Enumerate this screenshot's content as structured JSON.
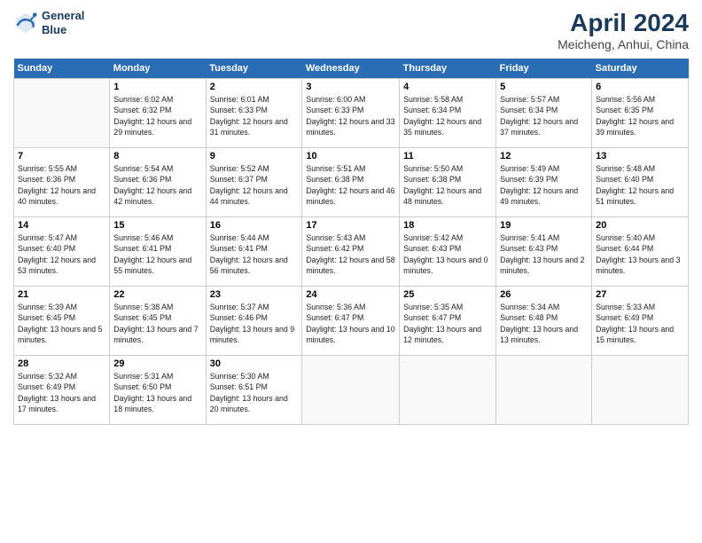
{
  "header": {
    "logo_line1": "General",
    "logo_line2": "Blue",
    "month": "April 2024",
    "location": "Meicheng, Anhui, China"
  },
  "days_of_week": [
    "Sunday",
    "Monday",
    "Tuesday",
    "Wednesday",
    "Thursday",
    "Friday",
    "Saturday"
  ],
  "weeks": [
    [
      {
        "day": "",
        "sunrise": "",
        "sunset": "",
        "daylight": ""
      },
      {
        "day": "1",
        "sunrise": "Sunrise: 6:02 AM",
        "sunset": "Sunset: 6:32 PM",
        "daylight": "Daylight: 12 hours and 29 minutes."
      },
      {
        "day": "2",
        "sunrise": "Sunrise: 6:01 AM",
        "sunset": "Sunset: 6:33 PM",
        "daylight": "Daylight: 12 hours and 31 minutes."
      },
      {
        "day": "3",
        "sunrise": "Sunrise: 6:00 AM",
        "sunset": "Sunset: 6:33 PM",
        "daylight": "Daylight: 12 hours and 33 minutes."
      },
      {
        "day": "4",
        "sunrise": "Sunrise: 5:58 AM",
        "sunset": "Sunset: 6:34 PM",
        "daylight": "Daylight: 12 hours and 35 minutes."
      },
      {
        "day": "5",
        "sunrise": "Sunrise: 5:57 AM",
        "sunset": "Sunset: 6:34 PM",
        "daylight": "Daylight: 12 hours and 37 minutes."
      },
      {
        "day": "6",
        "sunrise": "Sunrise: 5:56 AM",
        "sunset": "Sunset: 6:35 PM",
        "daylight": "Daylight: 12 hours and 39 minutes."
      }
    ],
    [
      {
        "day": "7",
        "sunrise": "Sunrise: 5:55 AM",
        "sunset": "Sunset: 6:36 PM",
        "daylight": "Daylight: 12 hours and 40 minutes."
      },
      {
        "day": "8",
        "sunrise": "Sunrise: 5:54 AM",
        "sunset": "Sunset: 6:36 PM",
        "daylight": "Daylight: 12 hours and 42 minutes."
      },
      {
        "day": "9",
        "sunrise": "Sunrise: 5:52 AM",
        "sunset": "Sunset: 6:37 PM",
        "daylight": "Daylight: 12 hours and 44 minutes."
      },
      {
        "day": "10",
        "sunrise": "Sunrise: 5:51 AM",
        "sunset": "Sunset: 6:38 PM",
        "daylight": "Daylight: 12 hours and 46 minutes."
      },
      {
        "day": "11",
        "sunrise": "Sunrise: 5:50 AM",
        "sunset": "Sunset: 6:38 PM",
        "daylight": "Daylight: 12 hours and 48 minutes."
      },
      {
        "day": "12",
        "sunrise": "Sunrise: 5:49 AM",
        "sunset": "Sunset: 6:39 PM",
        "daylight": "Daylight: 12 hours and 49 minutes."
      },
      {
        "day": "13",
        "sunrise": "Sunrise: 5:48 AM",
        "sunset": "Sunset: 6:40 PM",
        "daylight": "Daylight: 12 hours and 51 minutes."
      }
    ],
    [
      {
        "day": "14",
        "sunrise": "Sunrise: 5:47 AM",
        "sunset": "Sunset: 6:40 PM",
        "daylight": "Daylight: 12 hours and 53 minutes."
      },
      {
        "day": "15",
        "sunrise": "Sunrise: 5:46 AM",
        "sunset": "Sunset: 6:41 PM",
        "daylight": "Daylight: 12 hours and 55 minutes."
      },
      {
        "day": "16",
        "sunrise": "Sunrise: 5:44 AM",
        "sunset": "Sunset: 6:41 PM",
        "daylight": "Daylight: 12 hours and 56 minutes."
      },
      {
        "day": "17",
        "sunrise": "Sunrise: 5:43 AM",
        "sunset": "Sunset: 6:42 PM",
        "daylight": "Daylight: 12 hours and 58 minutes."
      },
      {
        "day": "18",
        "sunrise": "Sunrise: 5:42 AM",
        "sunset": "Sunset: 6:43 PM",
        "daylight": "Daylight: 13 hours and 0 minutes."
      },
      {
        "day": "19",
        "sunrise": "Sunrise: 5:41 AM",
        "sunset": "Sunset: 6:43 PM",
        "daylight": "Daylight: 13 hours and 2 minutes."
      },
      {
        "day": "20",
        "sunrise": "Sunrise: 5:40 AM",
        "sunset": "Sunset: 6:44 PM",
        "daylight": "Daylight: 13 hours and 3 minutes."
      }
    ],
    [
      {
        "day": "21",
        "sunrise": "Sunrise: 5:39 AM",
        "sunset": "Sunset: 6:45 PM",
        "daylight": "Daylight: 13 hours and 5 minutes."
      },
      {
        "day": "22",
        "sunrise": "Sunrise: 5:38 AM",
        "sunset": "Sunset: 6:45 PM",
        "daylight": "Daylight: 13 hours and 7 minutes."
      },
      {
        "day": "23",
        "sunrise": "Sunrise: 5:37 AM",
        "sunset": "Sunset: 6:46 PM",
        "daylight": "Daylight: 13 hours and 9 minutes."
      },
      {
        "day": "24",
        "sunrise": "Sunrise: 5:36 AM",
        "sunset": "Sunset: 6:47 PM",
        "daylight": "Daylight: 13 hours and 10 minutes."
      },
      {
        "day": "25",
        "sunrise": "Sunrise: 5:35 AM",
        "sunset": "Sunset: 6:47 PM",
        "daylight": "Daylight: 13 hours and 12 minutes."
      },
      {
        "day": "26",
        "sunrise": "Sunrise: 5:34 AM",
        "sunset": "Sunset: 6:48 PM",
        "daylight": "Daylight: 13 hours and 13 minutes."
      },
      {
        "day": "27",
        "sunrise": "Sunrise: 5:33 AM",
        "sunset": "Sunset: 6:49 PM",
        "daylight": "Daylight: 13 hours and 15 minutes."
      }
    ],
    [
      {
        "day": "28",
        "sunrise": "Sunrise: 5:32 AM",
        "sunset": "Sunset: 6:49 PM",
        "daylight": "Daylight: 13 hours and 17 minutes."
      },
      {
        "day": "29",
        "sunrise": "Sunrise: 5:31 AM",
        "sunset": "Sunset: 6:50 PM",
        "daylight": "Daylight: 13 hours and 18 minutes."
      },
      {
        "day": "30",
        "sunrise": "Sunrise: 5:30 AM",
        "sunset": "Sunset: 6:51 PM",
        "daylight": "Daylight: 13 hours and 20 minutes."
      },
      {
        "day": "",
        "sunrise": "",
        "sunset": "",
        "daylight": ""
      },
      {
        "day": "",
        "sunrise": "",
        "sunset": "",
        "daylight": ""
      },
      {
        "day": "",
        "sunrise": "",
        "sunset": "",
        "daylight": ""
      },
      {
        "day": "",
        "sunrise": "",
        "sunset": "",
        "daylight": ""
      }
    ]
  ]
}
